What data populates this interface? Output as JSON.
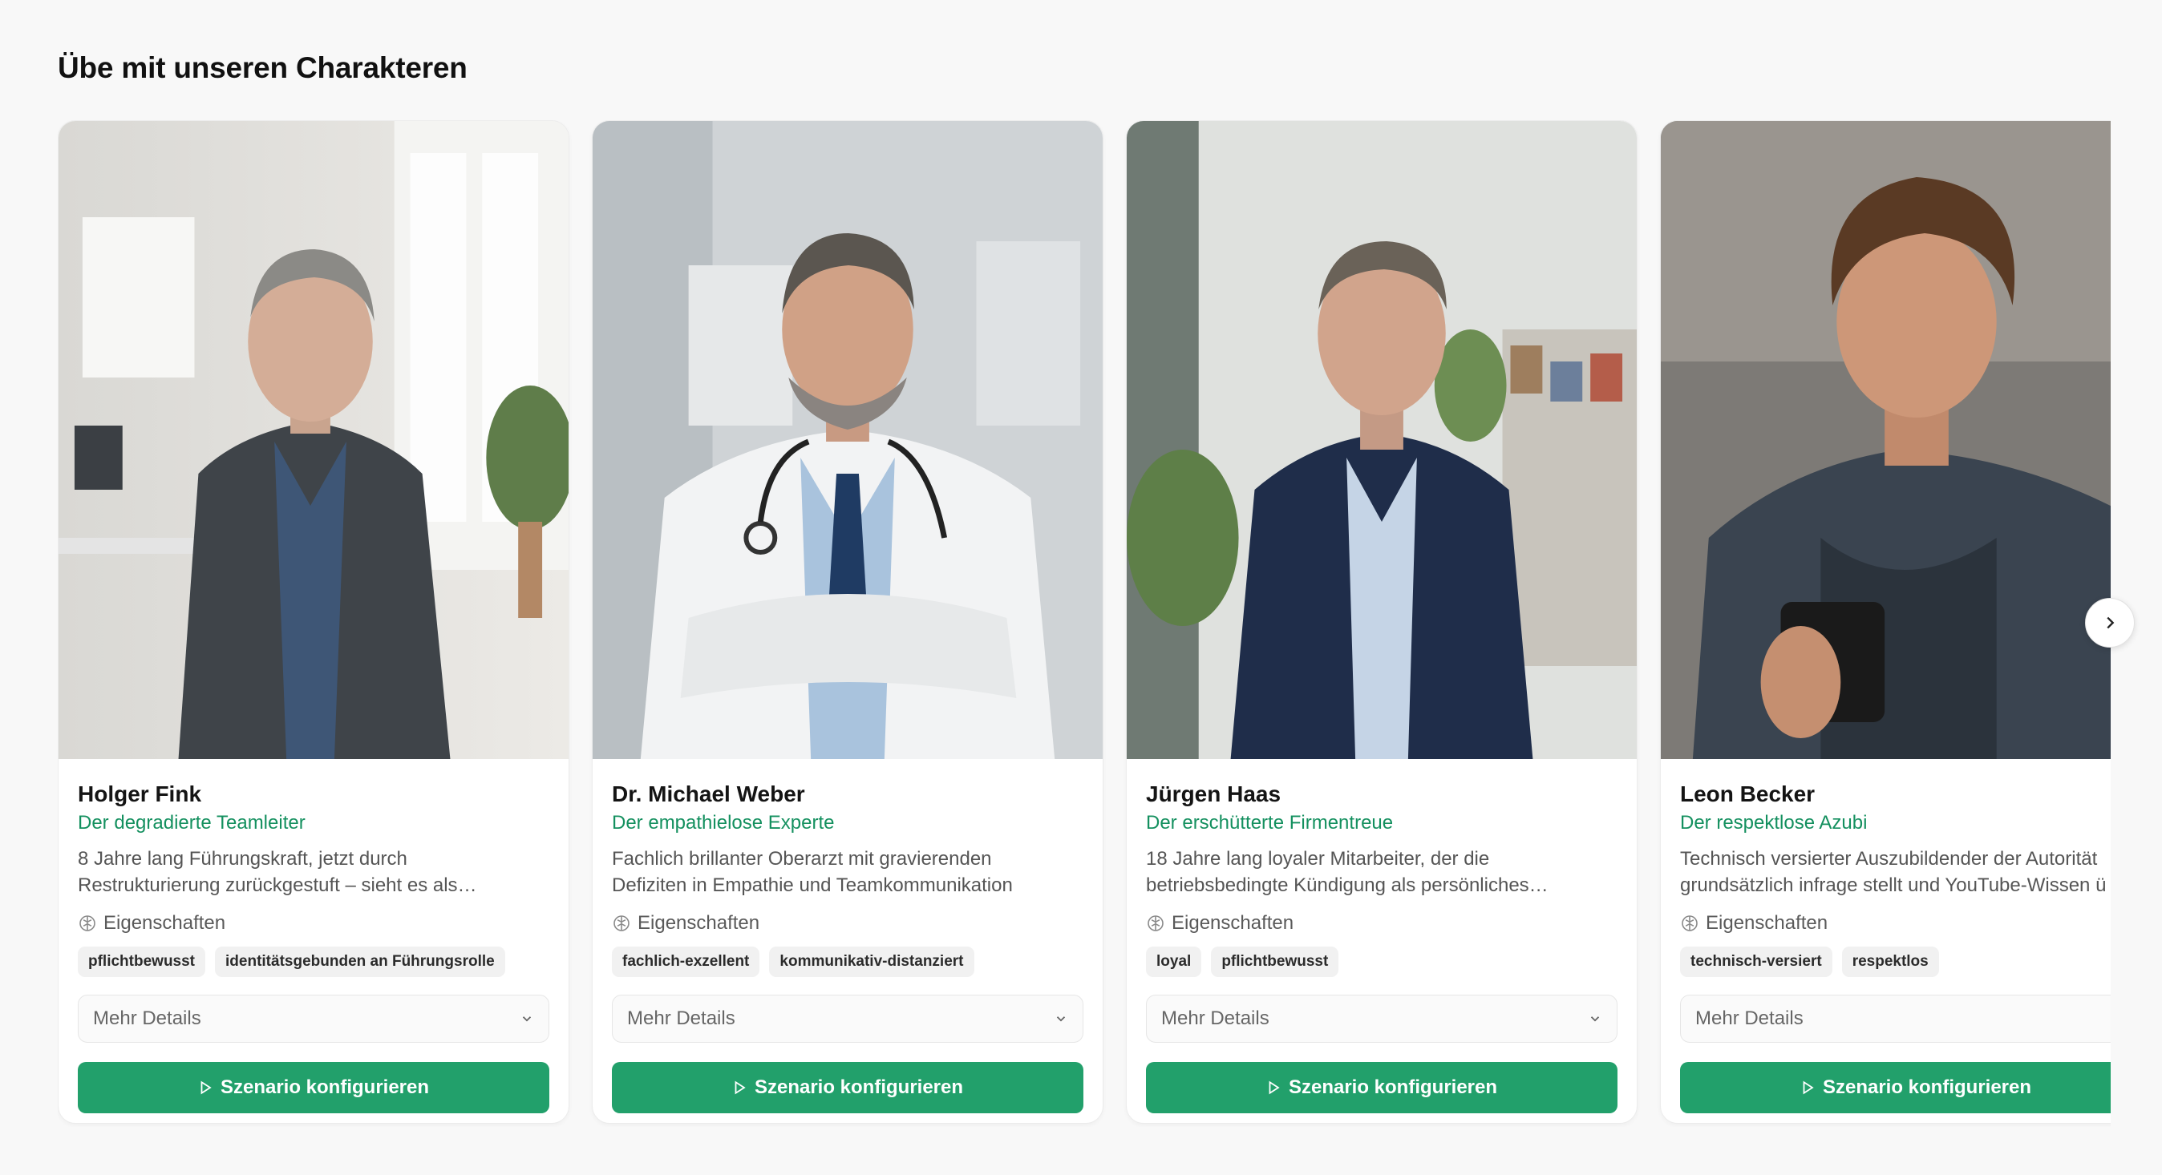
{
  "section": {
    "title": "Übe mit unseren Charakteren"
  },
  "theme": {
    "accent": "#22a06b",
    "accent_text": "#14905f"
  },
  "carousel": {
    "next_icon": "chevron-right-icon"
  },
  "characters": [
    {
      "name": "Holger Fink",
      "role": "Der degradierte Teamleiter",
      "description_line1": "8 Jahre lang Führungskraft, jetzt durch",
      "description_line2": "Restrukturierung zurückgestuft – sieht es als…",
      "traits_label": "Eigenschaften",
      "tags": [
        "pflichtbewusst",
        "identitätsgebunden an Führungsrolle"
      ],
      "details_label": "Mehr Details",
      "cta_label": "Szenario konfigurieren"
    },
    {
      "name": "Dr. Michael Weber",
      "role": "Der empathielose Experte",
      "description_line1": "Fachlich brillanter Oberarzt mit gravierenden",
      "description_line2": "Defiziten in Empathie und Teamkommunikation",
      "traits_label": "Eigenschaften",
      "tags": [
        "fachlich-exzellent",
        "kommunikativ-distanziert"
      ],
      "details_label": "Mehr Details",
      "cta_label": "Szenario konfigurieren"
    },
    {
      "name": "Jürgen Haas",
      "role": "Der erschütterte Firmentreue",
      "description_line1": "18 Jahre lang loyaler Mitarbeiter, der die",
      "description_line2": "betriebsbedingte Kündigung als persönliches…",
      "traits_label": "Eigenschaften",
      "tags": [
        "loyal",
        "pflichtbewusst"
      ],
      "details_label": "Mehr Details",
      "cta_label": "Szenario konfigurieren"
    },
    {
      "name": "Leon Becker",
      "role": "Der respektlose Azubi",
      "description_line1": "Technisch versierter Auszubildender der Autorität",
      "description_line2": "grundsätzlich infrage stellt und YouTube-Wissen ü",
      "traits_label": "Eigenschaften",
      "tags": [
        "technisch-versiert",
        "respektlos"
      ],
      "details_label": "Mehr Details",
      "cta_label": "Szenario konfigurieren"
    }
  ]
}
